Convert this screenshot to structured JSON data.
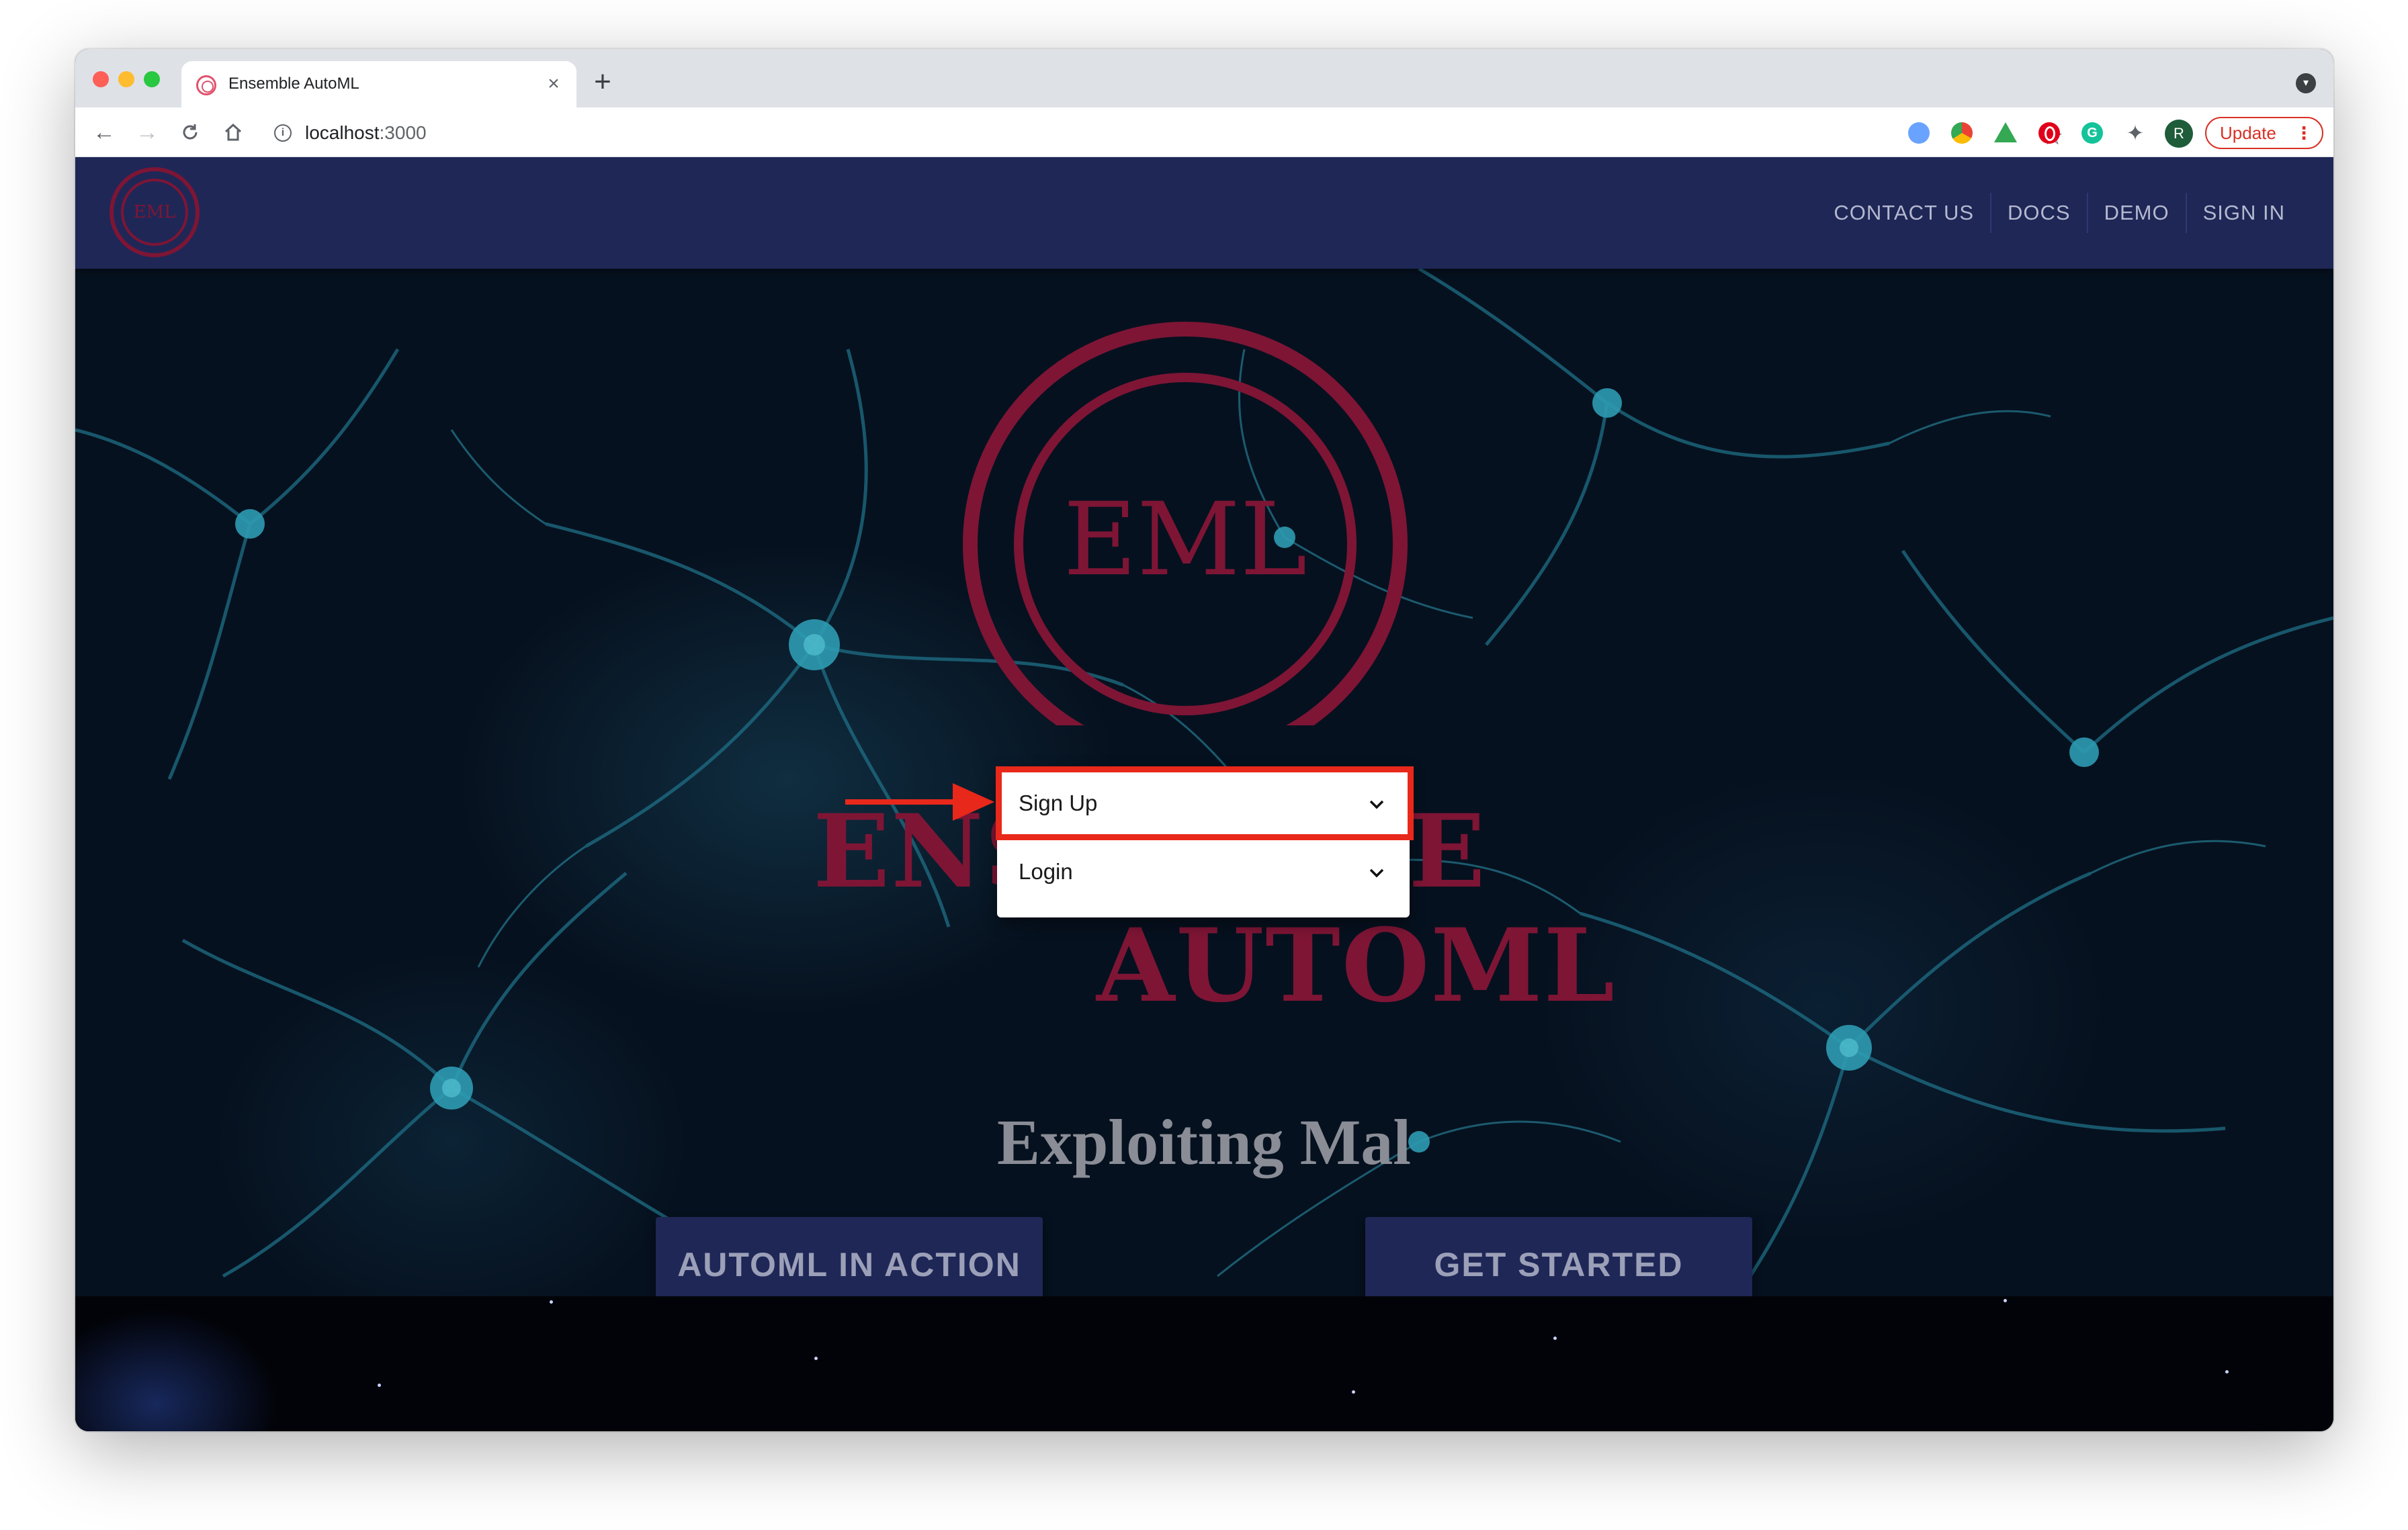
{
  "browser": {
    "tab_title": "Ensemble AutoML",
    "url_host": "localhost",
    "url_port": ":3000",
    "update_label": "Update",
    "avatar_initial": "R",
    "new_tab_glyph": "+",
    "close_glyph": "×"
  },
  "site": {
    "logo_text": "EML",
    "nav": [
      "CONTACT US",
      "DOCS",
      "DEMO",
      "SIGN IN"
    ]
  },
  "hero": {
    "brand_line_1": "ENSEMBLE",
    "brand_line_2": "AUTOML",
    "tagline": "Exploiting Mal",
    "cta_primary": "AUTOML IN ACTION",
    "cta_secondary": "GET STARTED"
  },
  "dropdown": {
    "items": [
      "Sign Up",
      "Login"
    ]
  },
  "annotation": {
    "highlight_color": "#e8281a"
  },
  "colors": {
    "header_bg": "#1f2757",
    "brand_crimson": "#7e1535",
    "button_bg": "#1f2757"
  }
}
